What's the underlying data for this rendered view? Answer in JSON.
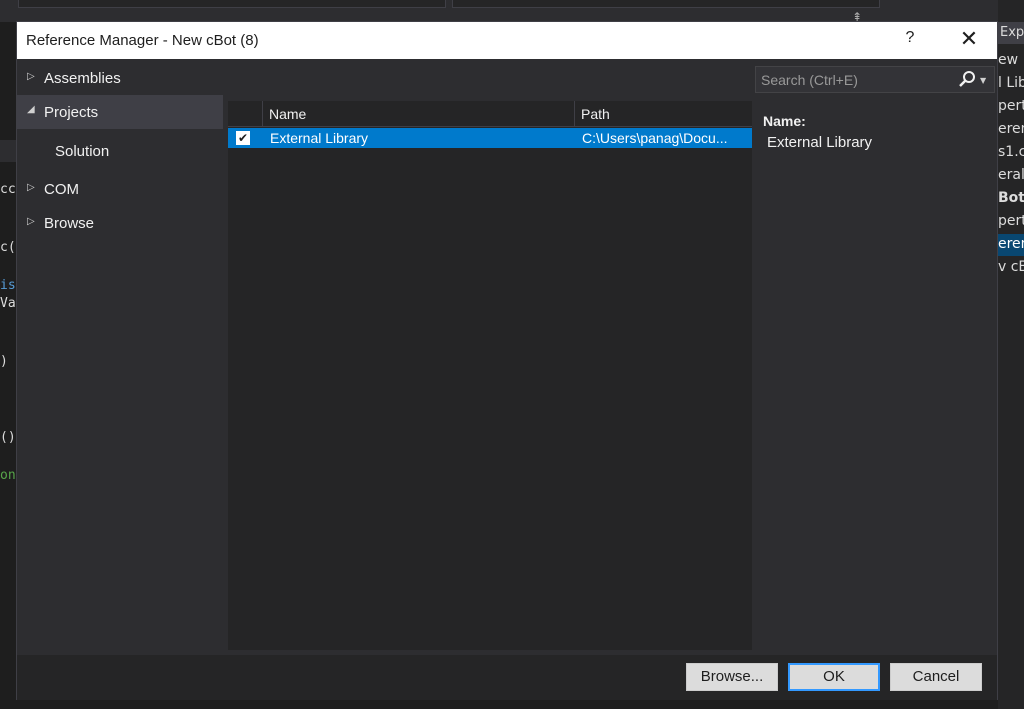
{
  "background_ide": {
    "code_fragments": [
      "cc",
      "c()",
      "is)",
      "Val",
      ")",
      "()",
      "on"
    ],
    "solution_fragments": [
      "Exp",
      "ew",
      "l Lib",
      "perti",
      "erenc",
      "s1.c",
      "eral",
      "Bot",
      "perti",
      "eren",
      "v cB"
    ]
  },
  "dialog": {
    "title": "Reference Manager - New cBot (8)",
    "help_label": "?",
    "close_label": "✕"
  },
  "nav": {
    "items": [
      {
        "label": "Assemblies",
        "expanded": false
      },
      {
        "label": "Projects",
        "expanded": true
      },
      {
        "label": "Solution"
      },
      {
        "label": "COM",
        "expanded": false
      },
      {
        "label": "Browse",
        "expanded": false
      }
    ]
  },
  "list": {
    "columns": [
      "Name",
      "Path"
    ],
    "rows": [
      {
        "checked": true,
        "name": "External Library",
        "path": "C:\\Users\\panag\\Docu..."
      }
    ]
  },
  "search": {
    "placeholder": "Search (Ctrl+E)"
  },
  "details": {
    "name_label": "Name:",
    "name_value": "External Library"
  },
  "buttons": {
    "browse": "Browse...",
    "ok": "OK",
    "cancel": "Cancel"
  },
  "colors": {
    "accent": "#007acc",
    "dialog_bg": "#2d2d30",
    "list_bg": "#252526"
  }
}
